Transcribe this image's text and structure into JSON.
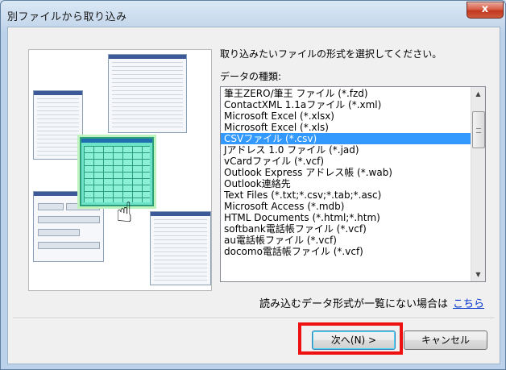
{
  "window": {
    "title": "別ファイルから取り込み",
    "close_label": "x"
  },
  "prompt": "取り込みたいファイルの形式を選択してください。",
  "list_label": "データの種類:",
  "formats": {
    "items": [
      "筆王ZERO/筆王 ファイル (*.fzd)",
      "ContactXML 1.1aファイル (*.xml)",
      "Microsoft Excel (*.xlsx)",
      "Microsoft Excel (*.xls)",
      "CSVファイル (*.csv)",
      "Jアドレス 1.0 ファイル (*.jad)",
      "vCardファイル (*.vcf)",
      "Outlook Express アドレス帳 (*.wab)",
      "Outlook連絡先",
      "Text Files (*.txt;*.csv;*.tab;*.asc)",
      "Microsoft Access (*.mdb)",
      "HTML Documents (*.html;*.htm)",
      "softbank電話帳ファイル (*.vcf)",
      "au電話帳ファイル (*.vcf)",
      "docomo電話帳ファイル (*.vcf)"
    ],
    "selected": "CSVファイル (*.csv)"
  },
  "note": {
    "text": "読み込むデータ形式が一覧にない場合は",
    "link": "こちら"
  },
  "buttons": {
    "next": "次へ(N) >",
    "cancel": "キャンセル"
  },
  "colors": {
    "selection": "#3399ff",
    "highlight": "#ee1111",
    "link": "#0033cc"
  }
}
